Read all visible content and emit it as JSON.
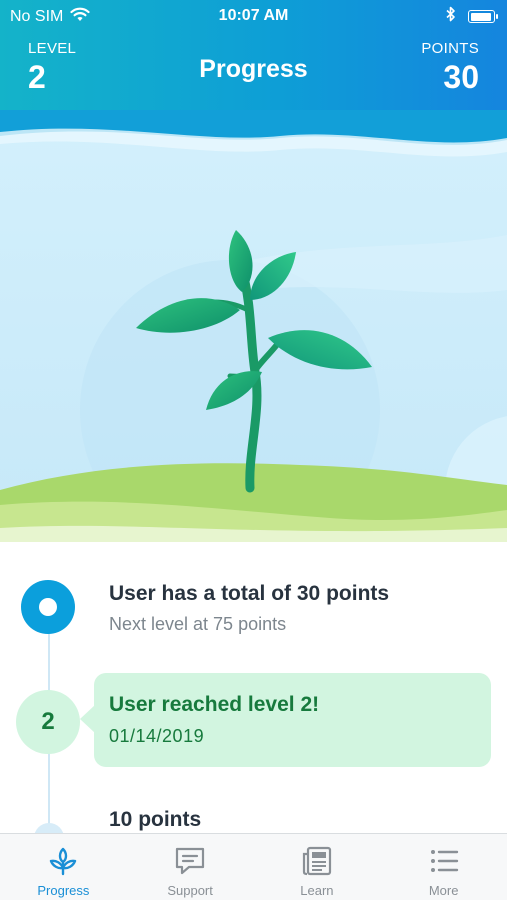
{
  "status_bar": {
    "carrier": "No SIM",
    "time": "10:07 AM",
    "icons": [
      "wifi-icon",
      "bluetooth-icon",
      "battery-icon"
    ]
  },
  "header": {
    "level_label": "LEVEL",
    "level_value": "2",
    "title": "Progress",
    "points_label": "POINTS",
    "points_value": "30"
  },
  "timeline": {
    "items": [
      {
        "title": "User has a total of 30 points",
        "subtitle": "Next level at 75 points"
      },
      {
        "badge": "2",
        "title": "User reached level 2!",
        "date": "01/14/2019"
      },
      {
        "title": "10 points"
      }
    ]
  },
  "tabs": [
    {
      "label": "Progress",
      "icon": "sprout-icon",
      "active": true
    },
    {
      "label": "Support",
      "icon": "chat-bubble-icon",
      "active": false
    },
    {
      "label": "Learn",
      "icon": "newspaper-icon",
      "active": false
    },
    {
      "label": "More",
      "icon": "list-icon",
      "active": false
    }
  ],
  "colors": {
    "header_gradient": [
      "#14b3c9",
      "#1585de"
    ],
    "accent_blue": "#0b9fdc",
    "level_green": "#177a3d",
    "level_card_bg": "#d2f5e0"
  }
}
